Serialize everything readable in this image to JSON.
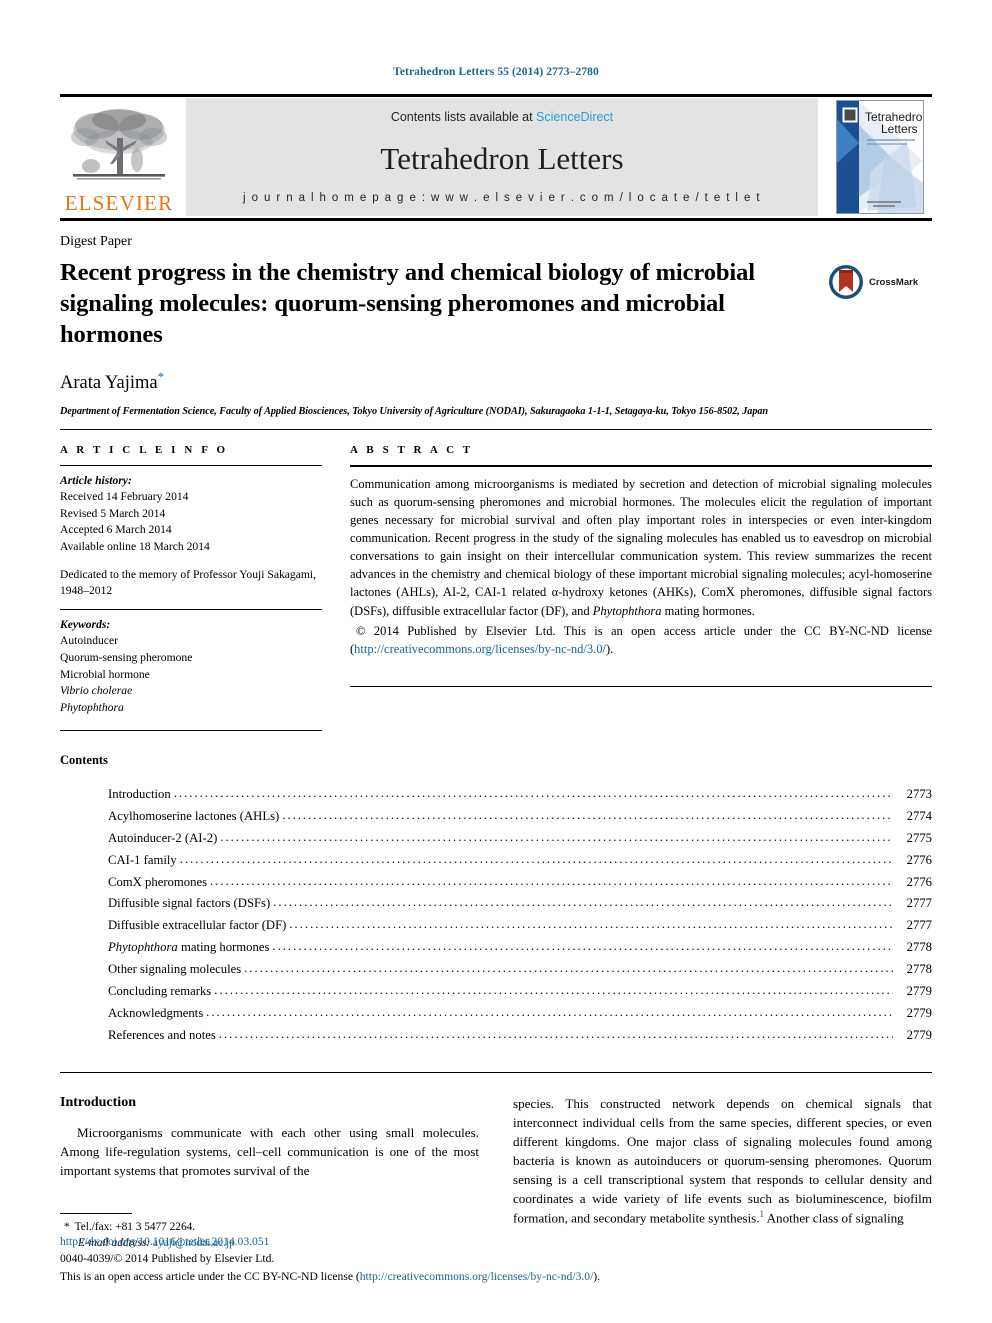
{
  "running_head": "Tetrahedron Letters 55 (2014) 2773–2780",
  "masthead": {
    "contents_prefix": "Contents lists available at ",
    "sciencedirect": "ScienceDirect",
    "journal_name": "Tetrahedron Letters",
    "homepage": "j o u r n a l   h o m e p a g e :   w w w . e l s e v i e r . c o m / l o c a t e / t e t l e t",
    "publisher": "ELSEVIER",
    "cover_title_line1": "Tetrahedron",
    "cover_title_line2": "Letters",
    "sciencedirect_color": "#2e9bd6",
    "elsevier_color": "#E87511"
  },
  "article": {
    "doctype": "Digest Paper",
    "title": "Recent progress in the chemistry and chemical biology of microbial signaling molecules: quorum-sensing pheromones and microbial hormones",
    "author": "Arata Yajima",
    "author_marker": "*",
    "affiliation": "Department of Fermentation Science, Faculty of Applied Biosciences, Tokyo University of Agriculture (NODAI), Sakuragaoka 1-1-1, Setagaya-ku, Tokyo 156-8502, Japan",
    "crossmark_label": "CrossMark"
  },
  "info": {
    "heading": "A R T I C L E   I N F O",
    "history_label": "Article history:",
    "history": [
      "Received 14 February 2014",
      "Revised 5 March 2014",
      "Accepted 6 March 2014",
      "Available online 18 March 2014"
    ],
    "dedication": "Dedicated to the memory of Professor Youji Sakagami, 1948–2012",
    "keywords_label": "Keywords:",
    "keywords": [
      {
        "text": "Autoinducer",
        "italic": false
      },
      {
        "text": "Quorum-sensing pheromone",
        "italic": false
      },
      {
        "text": "Microbial hormone",
        "italic": false
      },
      {
        "text": "Vibrio cholerae",
        "italic": true
      },
      {
        "text": "Phytophthora",
        "italic": true
      }
    ]
  },
  "abstract": {
    "heading": "A B S T R A C T",
    "body": "Communication among microorganisms is mediated by secretion and detection of microbial signaling molecules such as quorum-sensing pheromones and microbial hormones. The molecules elicit the regulation of important genes necessary for microbial survival and often play important roles in interspecies or even inter-kingdom communication. Recent progress in the study of the signaling molecules has enabled us to eavesdrop on microbial conversations to gain insight on their intercellular communication system. This review summarizes the recent advances in the chemistry and chemical biology of these important microbial signaling molecules; acyl-homoserine lactones (AHLs), AI-2, CAI-1 related α-hydroxy ketones (AHKs), ComX pheromones, diffusible signal factors (DSFs), diffusible extracellular factor (DF), and Phytophthora mating hormones.",
    "italic_term": "Phytophthora",
    "copyright_text": "© 2014 Published by Elsevier Ltd. This is an open access article under the CC BY-NC-ND license (",
    "copyright_link": "http://creativecommons.org/licenses/by-nc-nd/3.0/",
    "copyright_tail": ")."
  },
  "contents": {
    "title": "Contents",
    "items": [
      {
        "label": "Introduction",
        "page": "2773",
        "italic_prefix": ""
      },
      {
        "label": "Acylhomoserine lactones (AHLs)",
        "page": "2774",
        "italic_prefix": ""
      },
      {
        "label": "Autoinducer-2 (AI-2)",
        "page": "2775",
        "italic_prefix": ""
      },
      {
        "label": "CAI-1 family",
        "page": "2776",
        "italic_prefix": ""
      },
      {
        "label": "ComX pheromones",
        "page": "2776",
        "italic_prefix": ""
      },
      {
        "label": "Diffusible signal factors (DSFs)",
        "page": "2777",
        "italic_prefix": ""
      },
      {
        "label": "Diffusible extracellular factor (DF)",
        "page": "2777",
        "italic_prefix": ""
      },
      {
        "label": " mating hormones",
        "page": "2778",
        "italic_prefix": "Phytophthora"
      },
      {
        "label": "Other signaling molecules",
        "page": "2778",
        "italic_prefix": ""
      },
      {
        "label": "Concluding remarks",
        "page": "2779",
        "italic_prefix": ""
      },
      {
        "label": "Acknowledgments",
        "page": "2779",
        "italic_prefix": ""
      },
      {
        "label": "References and notes",
        "page": "2779",
        "italic_prefix": ""
      }
    ]
  },
  "introduction": {
    "heading": "Introduction",
    "left_para": "Microorganisms communicate with each other using small molecules. Among life-regulation systems, cell–cell communication is one of the most important systems that promotes survival of the",
    "right_para_before_sup": "species. This constructed network depends on chemical signals that interconnect individual cells from the same species, different species, or even different kingdoms. One major class of signaling molecules found among bacteria is known as autoinducers or quorum-sensing pheromones. Quorum sensing is a cell transcriptional system that responds to cellular density and coordinates a wide variety of life events such as bioluminescence, biofilm formation, and secondary metabolite synthesis.",
    "right_sup": "1",
    "right_para_after_sup": " Another class of signaling"
  },
  "footnote": {
    "marker": "*",
    "tel": "Tel./fax: +81 3 5477 2264.",
    "email_label": "E-mail address:",
    "email": "ayaji@nodai.ac.jp"
  },
  "bottom": {
    "doi": "http://dx.doi.org/10.1016/j.tetlet.2014.03.051",
    "issn_line": "0040-4039/© 2014 Published by Elsevier Ltd.",
    "oa_prefix": "This is an open access article under the CC BY-NC-ND license (",
    "oa_link": "http://creativecommons.org/licenses/by-nc-nd/3.0/",
    "oa_tail": ")."
  },
  "colors": {
    "link": "#1a6496",
    "band": "#e3e3e3"
  }
}
